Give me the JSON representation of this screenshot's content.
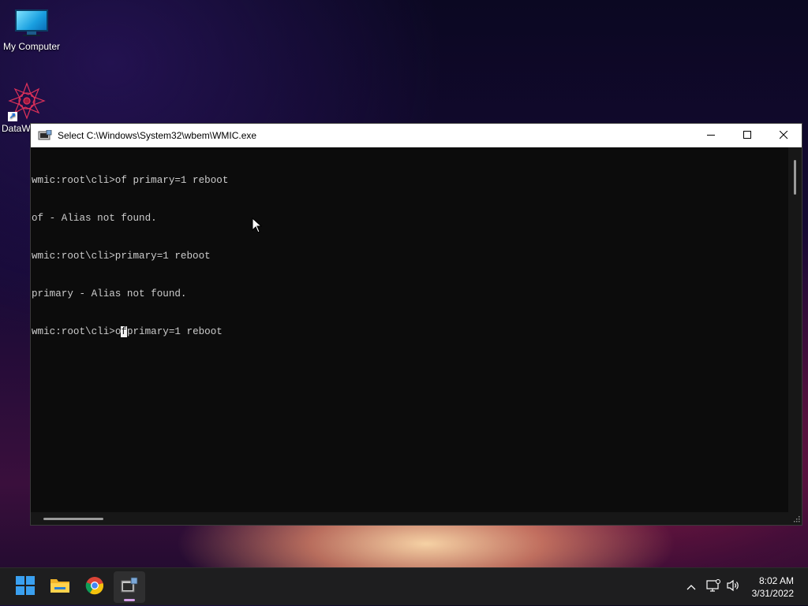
{
  "desktop": {
    "icons": [
      {
        "label": "My Computer"
      },
      {
        "label": "DataW"
      }
    ]
  },
  "window": {
    "title": "Select C:\\Windows\\System32\\wbem\\WMIC.exe",
    "minimize_icon": "—",
    "maximize_icon": "☐",
    "close_icon": "✕",
    "console": {
      "lines": [
        "wmic:root\\cli>of primary=1 reboot",
        "of - Alias not found.",
        "wmic:root\\cli>primary=1 reboot",
        "primary - Alias not found."
      ],
      "current_prompt": "wmic:root\\cli>",
      "current_before_cursor": "o",
      "current_cursor_char": "f",
      "current_after_cursor": "primary=1 reboot"
    }
  },
  "taskbar": {
    "items": [
      {
        "name": "start",
        "icon": "windows-logo-icon"
      },
      {
        "name": "file-explorer",
        "icon": "folder-icon"
      },
      {
        "name": "chrome",
        "icon": "chrome-icon"
      },
      {
        "name": "wmic",
        "icon": "console-app-icon",
        "active": true
      }
    ],
    "tray": {
      "chevron": "^",
      "time": "8:02 AM",
      "date": "3/31/2022"
    }
  },
  "colors": {
    "console_bg": "#0c0c0c",
    "console_text": "#cccccc",
    "taskbar_bg": "#1e1e1f",
    "accent": "#d39fe8"
  }
}
